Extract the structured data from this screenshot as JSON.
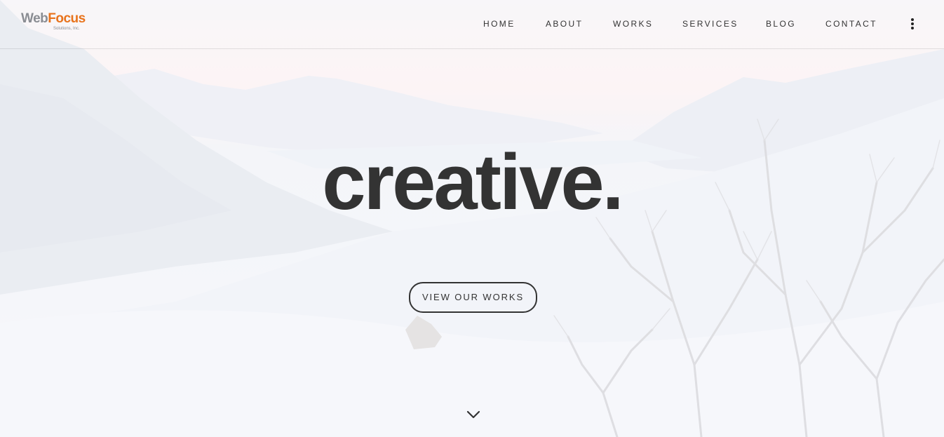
{
  "header": {
    "logo": {
      "brand_part1": "Web",
      "brand_part2": "Focus",
      "tagline": "Solutions, Inc."
    },
    "nav": [
      {
        "label": "HOME"
      },
      {
        "label": "ABOUT"
      },
      {
        "label": "WORKS"
      },
      {
        "label": "SERVICES"
      },
      {
        "label": "BLOG"
      },
      {
        "label": "CONTACT"
      }
    ],
    "menu_icon": "vertical-dots-icon"
  },
  "hero": {
    "headline": "creative.",
    "cta_label": "VIEW OUR WORKS",
    "scroll_icon": "chevron-down-icon",
    "background": "snowy-mountain-landscape"
  },
  "colors": {
    "text": "#333333",
    "logo_gray": "#8a8d93",
    "logo_orange": "#e8731c"
  }
}
